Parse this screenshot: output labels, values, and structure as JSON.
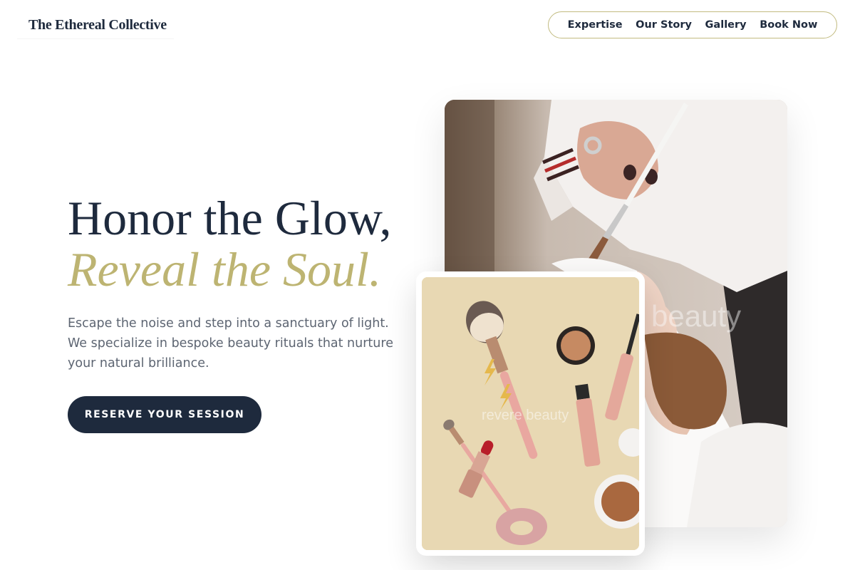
{
  "brand": {
    "name": "The Ethereal Collective"
  },
  "nav": {
    "items": [
      {
        "label": "Expertise"
      },
      {
        "label": "Our Story"
      },
      {
        "label": "Gallery"
      },
      {
        "label": "Book Now"
      }
    ]
  },
  "hero": {
    "title_line1": "Honor the Glow,",
    "title_line2": "Reveal the Soul.",
    "description": "Escape the noise and step into a sanctuary of light. We specialize in bespoke beauty rituals that nurture your natural brilliance.",
    "cta_label": "RESERVE YOUR SESSION"
  },
  "images": {
    "main_watermark": "beauty",
    "card_watermark": "revere beauty"
  },
  "colors": {
    "primary": "#1e2a3d",
    "accent": "#bdb472",
    "text_muted": "#5d6572",
    "nav_border": "#c2bb80",
    "card_background": "#e7d7b2"
  }
}
